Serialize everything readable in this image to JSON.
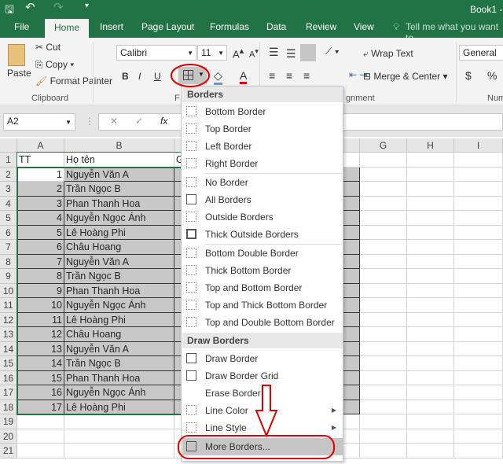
{
  "title": {
    "text": "Book1 -"
  },
  "tabs": [
    {
      "label": "File"
    },
    {
      "label": "Home",
      "active": true
    },
    {
      "label": "Insert"
    },
    {
      "label": "Page Layout"
    },
    {
      "label": "Formulas"
    },
    {
      "label": "Data"
    },
    {
      "label": "Review"
    },
    {
      "label": "View"
    }
  ],
  "tell_me": "Tell me what you want to",
  "clipboard": {
    "paste": "Paste",
    "cut": "Cut",
    "copy": "Copy",
    "format_painter": "Format Painter",
    "label": "Clipboard"
  },
  "font": {
    "name": "Calibri",
    "size": "11",
    "bold": "B",
    "italic": "I",
    "underline": "U",
    "label": "F"
  },
  "alignment": {
    "wrap_text": "Wrap Text",
    "merge_center": "Merge & Center",
    "label": "gnment"
  },
  "number": {
    "format": "General",
    "currency": "$",
    "percent": "%",
    "label": "Num"
  },
  "formula_bar": {
    "name_box": "A2",
    "fx": "fx",
    "value": ""
  },
  "columns": [
    "A",
    "B",
    "G",
    "H",
    "I"
  ],
  "header_row": {
    "a": "TT",
    "b": "Họ tên",
    "c": "G"
  },
  "rows": [
    {
      "n": "1",
      "name": "Nguyễn Văn A"
    },
    {
      "n": "2",
      "name": "Trần Ngọc B"
    },
    {
      "n": "3",
      "name": "Phan Thanh Hoa"
    },
    {
      "n": "4",
      "name": "Nguyễn Ngọc Ánh"
    },
    {
      "n": "5",
      "name": "Lê Hoàng Phi"
    },
    {
      "n": "6",
      "name": "Châu Hoang"
    },
    {
      "n": "7",
      "name": "Nguyễn Văn A"
    },
    {
      "n": "8",
      "name": "Trần Ngọc B"
    },
    {
      "n": "9",
      "name": "Phan Thanh Hoa"
    },
    {
      "n": "10",
      "name": "Nguyễn Ngọc Ánh"
    },
    {
      "n": "11",
      "name": "Lê Hoàng Phi"
    },
    {
      "n": "12",
      "name": "Châu Hoang"
    },
    {
      "n": "13",
      "name": "Nguyễn Văn A"
    },
    {
      "n": "14",
      "name": "Trần Ngọc B"
    },
    {
      "n": "15",
      "name": "Phan Thanh Hoa"
    },
    {
      "n": "16",
      "name": "Nguyễn Ngọc Ánh"
    },
    {
      "n": "17",
      "name": "Lê Hoàng Phi"
    }
  ],
  "row_numbers": [
    "1",
    "2",
    "3",
    "4",
    "5",
    "6",
    "7",
    "8",
    "9",
    "10",
    "11",
    "12",
    "13",
    "14",
    "15",
    "16",
    "17",
    "18",
    "19",
    "20",
    "21"
  ],
  "menu": {
    "borders_header": "Borders",
    "items1": [
      "Bottom Border",
      "Top Border",
      "Left Border",
      "Right Border"
    ],
    "items2": [
      "No Border",
      "All Borders",
      "Outside Borders",
      "Thick Outside Borders"
    ],
    "items3": [
      "Bottom Double Border",
      "Thick Bottom Border",
      "Top and Bottom Border",
      "Top and Thick Bottom Border",
      "Top and Double Bottom Border"
    ],
    "draw_header": "Draw Borders",
    "items4": [
      "Draw Border",
      "Draw Border Grid",
      "Erase Border",
      "Line Color",
      "Line Style"
    ],
    "more": "More Borders..."
  },
  "colors": {
    "excel_green": "#217346",
    "annotation_red": "#e00000",
    "selection": "#c8c8c8"
  }
}
